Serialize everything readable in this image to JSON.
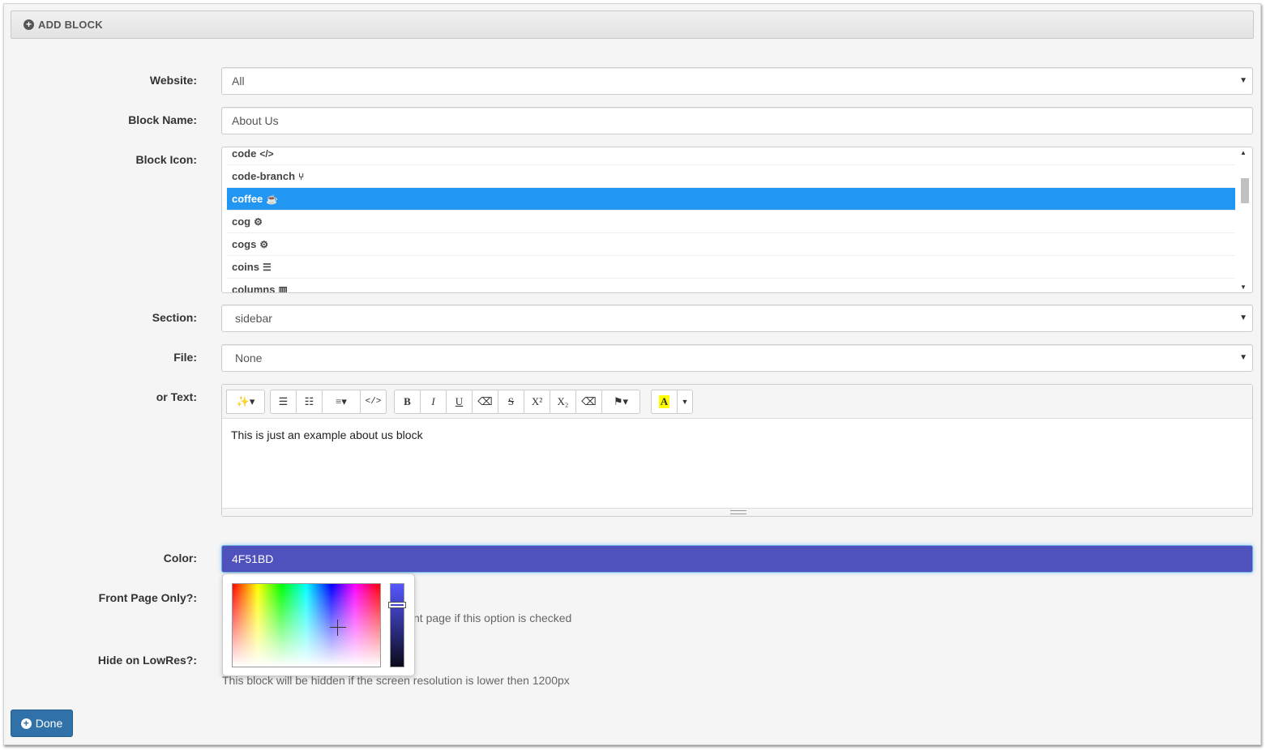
{
  "header": {
    "title": "ADD BLOCK"
  },
  "form": {
    "website": {
      "label": "Website:",
      "value": "All"
    },
    "block_name": {
      "label": "Block Name:",
      "value": "About Us"
    },
    "block_icon": {
      "label": "Block Icon:",
      "items": [
        {
          "name": "code",
          "icon": "</>"
        },
        {
          "name": "code-branch",
          "icon": "⑂"
        },
        {
          "name": "coffee",
          "icon": "☕"
        },
        {
          "name": "cog",
          "icon": "⚙"
        },
        {
          "name": "cogs",
          "icon": "⚙"
        },
        {
          "name": "coins",
          "icon": "☰"
        },
        {
          "name": "columns",
          "icon": "▥"
        }
      ],
      "selected": "coffee"
    },
    "section": {
      "label": "Section:",
      "value": "sidebar"
    },
    "file": {
      "label": "File:",
      "value": "None"
    },
    "text": {
      "label": "or Text:",
      "content": "This is just an example about us block",
      "toolbar": {
        "bold": "B",
        "italic": "I",
        "underline": "U",
        "strike": "S",
        "superscript": "X²",
        "subscript": "X₂",
        "highlight": "A"
      }
    },
    "color": {
      "label": "Color:",
      "value": "4F51BD",
      "hex": "#4F51BD"
    },
    "front_page": {
      "label": "Front Page Only?:",
      "help": "nt page if this option is checked"
    },
    "hide_lowres": {
      "label": "Hide on LowRes?:",
      "help": "This block will be hidden if the screen resolution is lower then 1200px"
    }
  },
  "done_button": {
    "label": "Done"
  }
}
